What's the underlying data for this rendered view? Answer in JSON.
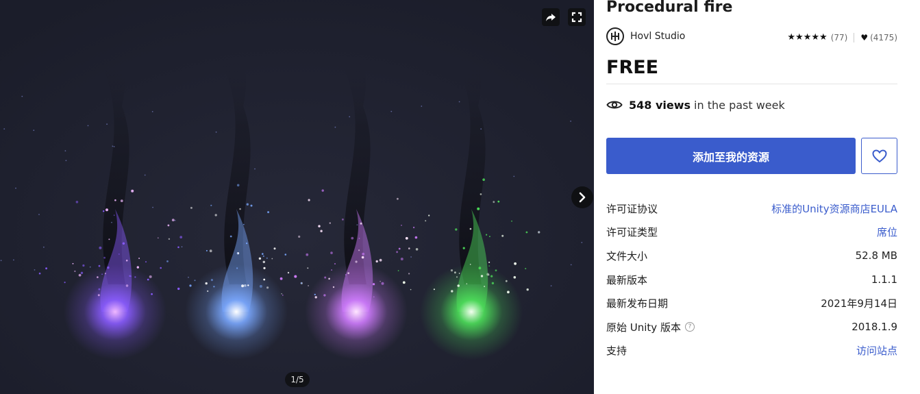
{
  "gallery": {
    "counter": "1/5",
    "flames": [
      {
        "color": "#8a5cff",
        "core": "#f0b8ff"
      },
      {
        "color": "#7aa8ff",
        "core": "#ffffff"
      },
      {
        "color": "#d07cff",
        "core": "#ffe6ff"
      },
      {
        "color": "#4de05a",
        "core": "#f4fff0"
      }
    ]
  },
  "product": {
    "title": "Procedural fire",
    "publisher": "Hovl Studio",
    "stars": "★★★★★",
    "rating_count": "(77)",
    "favorites_count": "(4175)",
    "price": "FREE",
    "views_count": "548 views",
    "views_suffix": "in the past week",
    "add_button_label": "添加至我的资源"
  },
  "details": [
    {
      "label": "许可证协议",
      "value": "标准的Unity资源商店EULA",
      "link": true
    },
    {
      "label": "许可证类型",
      "value": "席位",
      "link": true
    },
    {
      "label": "文件大小",
      "value": "52.8 MB",
      "link": false
    },
    {
      "label": "最新版本",
      "value": "1.1.1",
      "link": false
    },
    {
      "label": "最新发布日期",
      "value": "2021年9月14日",
      "link": false
    },
    {
      "label": "原始 Unity 版本",
      "value": "2018.1.9",
      "link": false,
      "help": true
    },
    {
      "label": "支持",
      "value": "访问站点",
      "link": true
    }
  ],
  "colors": {
    "accent": "#3a5ccc",
    "gallery_bg": "#1f2130"
  }
}
